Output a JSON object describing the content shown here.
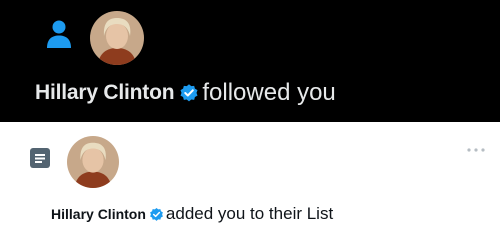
{
  "colors": {
    "accent": "#1d9bf0",
    "dark_bg": "#000000",
    "light_bg": "#ffffff",
    "dark_text": "#e7e9ea",
    "light_text": "#0f1419",
    "list_icon": "#536471"
  },
  "notifications": [
    {
      "theme": "dark",
      "icon": "person-icon",
      "avatar": "avatar",
      "user_name": "Hillary Clinton",
      "verified_icon": "verified-badge-icon",
      "action_text": "followed you"
    },
    {
      "theme": "light",
      "icon": "list-icon",
      "avatar": "avatar",
      "user_name": "Hillary Clinton",
      "verified_icon": "verified-badge-icon",
      "action_text": "added you to their List",
      "menu_icon": "more-dots-icon"
    }
  ]
}
